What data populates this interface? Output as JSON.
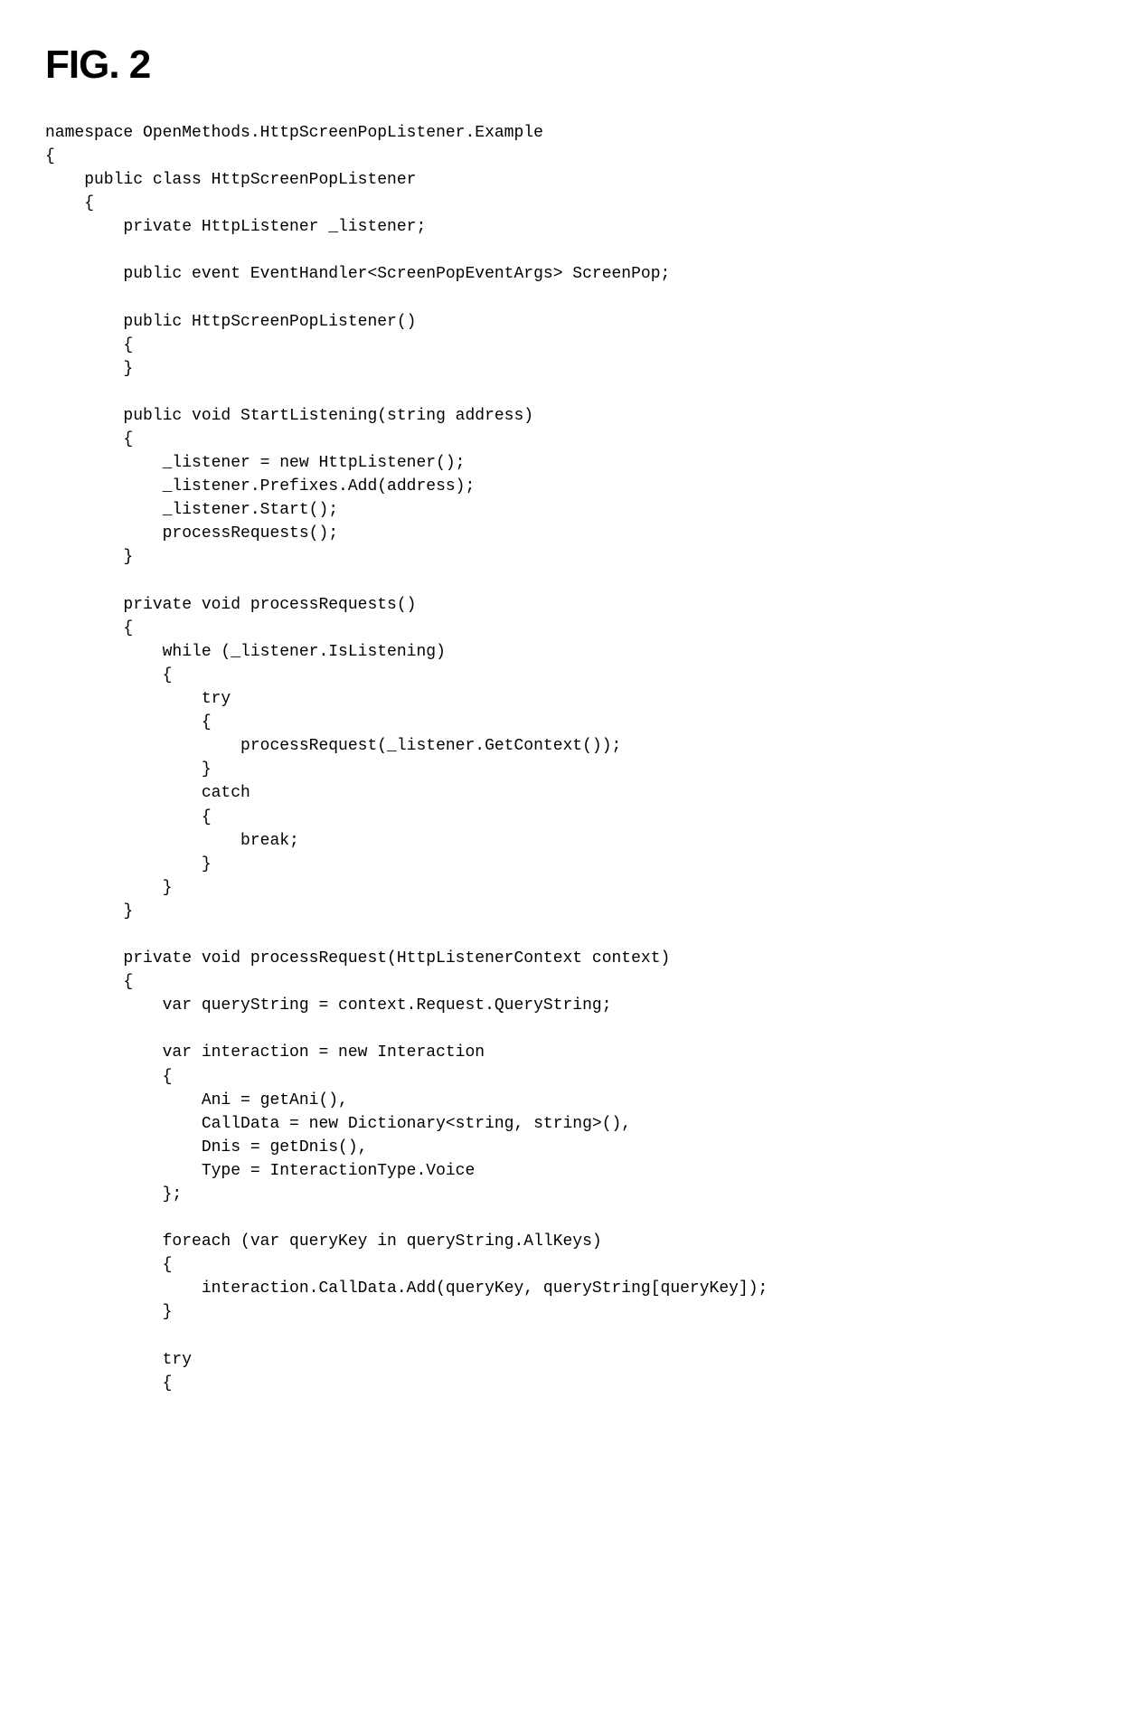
{
  "figure_label": "FIG. 2",
  "code": "namespace OpenMethods.HttpScreenPopListener.Example\n{\n    public class HttpScreenPopListener\n    {\n        private HttpListener _listener;\n\n        public event EventHandler<ScreenPopEventArgs> ScreenPop;\n\n        public HttpScreenPopListener()\n        {\n        }\n\n        public void StartListening(string address)\n        {\n            _listener = new HttpListener();\n            _listener.Prefixes.Add(address);\n            _listener.Start();\n            processRequests();\n        }\n\n        private void processRequests()\n        {\n            while (_listener.IsListening)\n            {\n                try\n                {\n                    processRequest(_listener.GetContext());\n                }\n                catch\n                {\n                    break;\n                }\n            }\n        }\n\n        private void processRequest(HttpListenerContext context)\n        {\n            var queryString = context.Request.QueryString;\n\n            var interaction = new Interaction\n            {\n                Ani = getAni(),\n                CallData = new Dictionary<string, string>(),\n                Dnis = getDnis(),\n                Type = InteractionType.Voice\n            };\n\n            foreach (var queryKey in queryString.AllKeys)\n            {\n                interaction.CallData.Add(queryKey, queryString[queryKey]);\n            }\n\n            try\n            {"
}
